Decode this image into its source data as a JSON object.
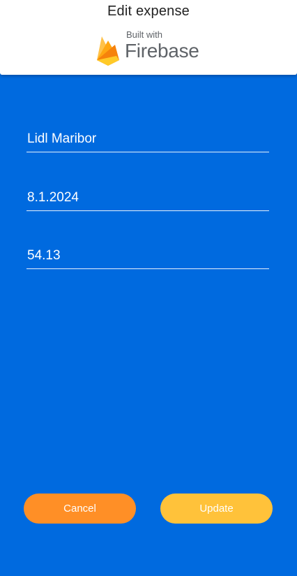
{
  "app_bar": {
    "title": "Edit expense",
    "badge_small_text": "Built with",
    "badge_brand_text": "Firebase",
    "badge_icon": "firebase-flame-icon"
  },
  "form": {
    "name_value": "Lidl Maribor",
    "date_value": "8.1.2024",
    "amount_value": "54.13"
  },
  "actions": {
    "cancel_label": "Cancel",
    "update_label": "Update"
  },
  "colors": {
    "background": "#006ADF",
    "header": "#FFFFFF",
    "cancel_button": "#FF8F26",
    "update_button": "#FFC23A",
    "firebase_text": "#5F6368"
  }
}
